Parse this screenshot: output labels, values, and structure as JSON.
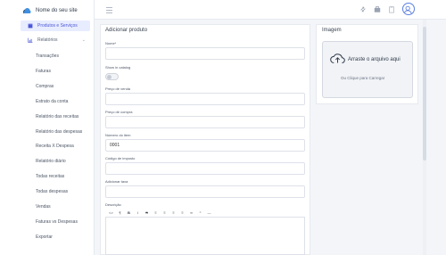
{
  "brand": {
    "name": "Nome do seu site"
  },
  "sidebar": {
    "items": [
      {
        "label": "Produtos e Serviços"
      },
      {
        "label": "Relatórios"
      }
    ],
    "sub_items": [
      "Transações",
      "Faturas",
      "Compras",
      "Estrato da conta",
      "Relatório das receitas",
      "Relatório das despesas",
      "Receita X Despesa",
      "Relatório diário",
      "Todas receitas",
      "Todas despesas",
      "Vendas",
      "Faturas vs Despesas",
      "Exportar"
    ]
  },
  "colors": {
    "accent": "#4a57d6",
    "active_bg": "#e8ecff",
    "avatar_border": "#5b7fe0"
  },
  "form": {
    "title": "Adicionar produto",
    "fields": {
      "nome": {
        "label": "Nome*",
        "value": ""
      },
      "show_catalog": {
        "label": "Show in catalog",
        "on": false
      },
      "preco_venda": {
        "label": "Preço de venda",
        "value": ""
      },
      "preco_compra": {
        "label": "Preço de compra",
        "value": ""
      },
      "numero_item": {
        "label": "Número do item",
        "value": "0001"
      },
      "codigo_imposto": {
        "label": "Código de imposto",
        "value": ""
      },
      "taxa": {
        "label": "Adicionar taxa",
        "value": ""
      },
      "descricao": {
        "label": "Descrição"
      }
    },
    "toolbar_buttons": [
      "<>",
      "¶",
      "B",
      "I",
      "S",
      "≡",
      "≡",
      "≡",
      "≡",
      "∞",
      "⁼",
      "—"
    ]
  },
  "image_panel": {
    "title": "Imagem",
    "dropzone_title": "Arraste o arquivo aqui",
    "dropzone_sub": "Ou Clique para Carregar"
  },
  "icons": [
    "menu-icon",
    "arrows-icon",
    "bag-icon",
    "clipboard-icon",
    "user-avatar-icon",
    "upload-icon",
    "cloud-logo-icon",
    "box-icon",
    "chart-icon",
    "chevron-down-icon"
  ]
}
